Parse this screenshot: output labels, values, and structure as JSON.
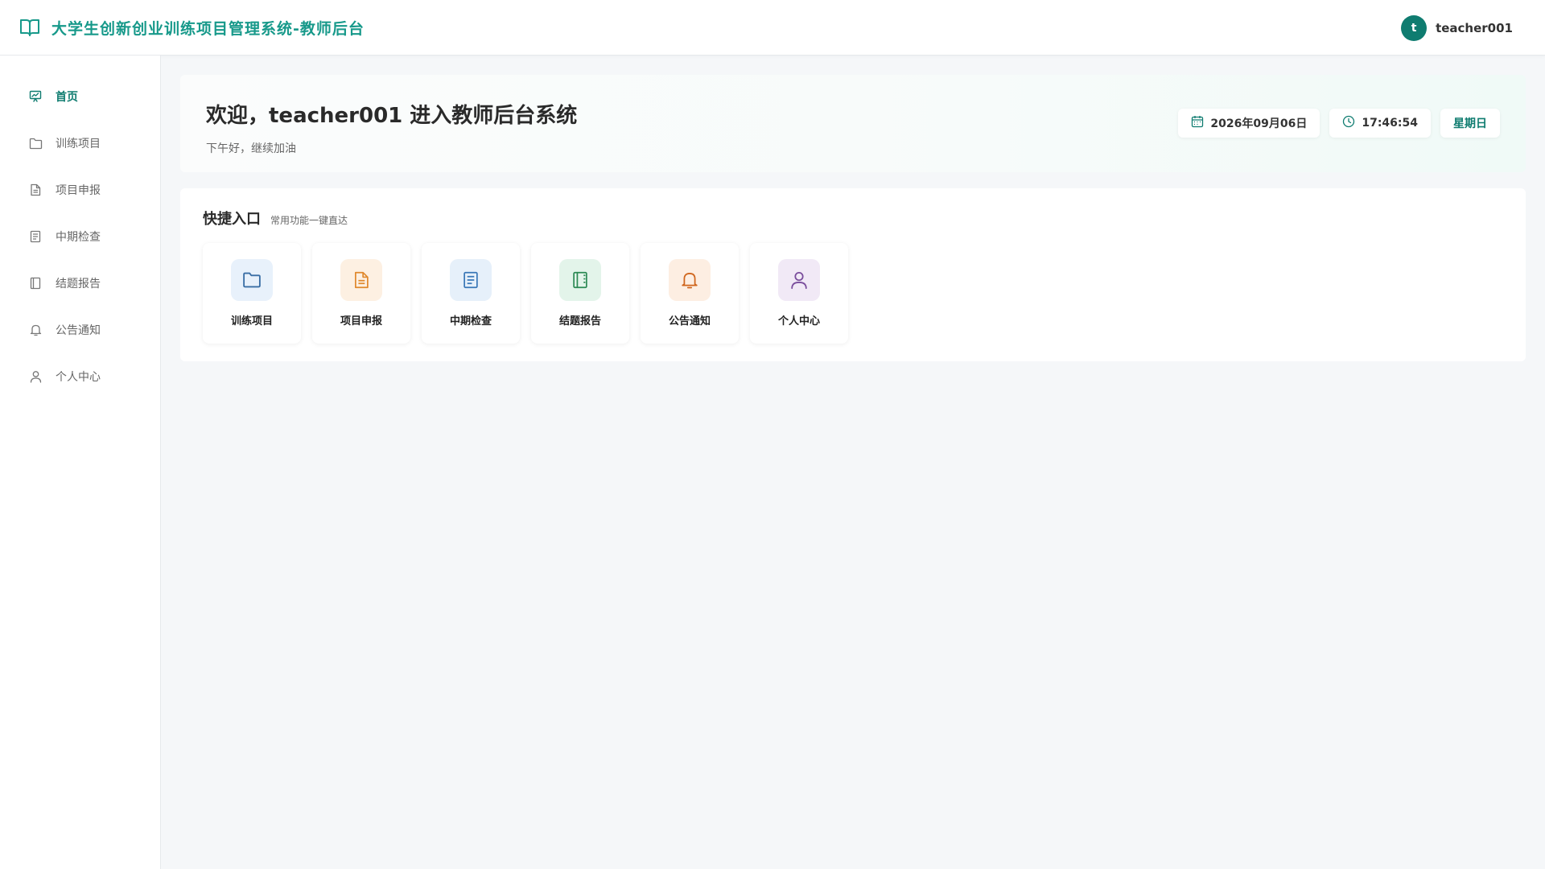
{
  "header": {
    "title": "大学生创新创业训练项目管理系统-教师后台",
    "avatar_letter": "t",
    "username": "teacher001"
  },
  "sidebar": {
    "items": [
      {
        "label": "首页",
        "icon": "chart-icon",
        "active": true
      },
      {
        "label": "训练项目",
        "icon": "folder-icon"
      },
      {
        "label": "项目申报",
        "icon": "document-icon"
      },
      {
        "label": "中期检查",
        "icon": "list-icon"
      },
      {
        "label": "结题报告",
        "icon": "notebook-icon"
      },
      {
        "label": "公告通知",
        "icon": "bell-icon"
      },
      {
        "label": "个人中心",
        "icon": "user-icon"
      }
    ]
  },
  "welcome": {
    "title": "欢迎，teacher001 进入教师后台系统",
    "subtitle": "下午好，继续加油",
    "date": "2026年09月06日",
    "time": "17:46:54",
    "weekday": "星期日"
  },
  "quick": {
    "title": "快捷入口",
    "subtitle": "常用功能一键直达",
    "cards": [
      {
        "label": "训练项目",
        "icon": "folder-icon",
        "color": "#3a6ea5",
        "bg": "#e8f1fb"
      },
      {
        "label": "项目申报",
        "icon": "document-icon",
        "color": "#e0892e",
        "bg": "#fdf0e2"
      },
      {
        "label": "中期检查",
        "icon": "list-icon",
        "color": "#3a78b8",
        "bg": "#e6f0fa"
      },
      {
        "label": "结题报告",
        "icon": "notebook-icon",
        "color": "#2d8a55",
        "bg": "#e3f4ea"
      },
      {
        "label": "公告通知",
        "icon": "bell-icon",
        "color": "#d0661e",
        "bg": "#fdeee2"
      },
      {
        "label": "个人中心",
        "icon": "user-icon",
        "color": "#7a4d9c",
        "bg": "#f1e9f6"
      }
    ]
  },
  "colors": {
    "accent": "#0f7c70",
    "brand": "#17998a"
  }
}
